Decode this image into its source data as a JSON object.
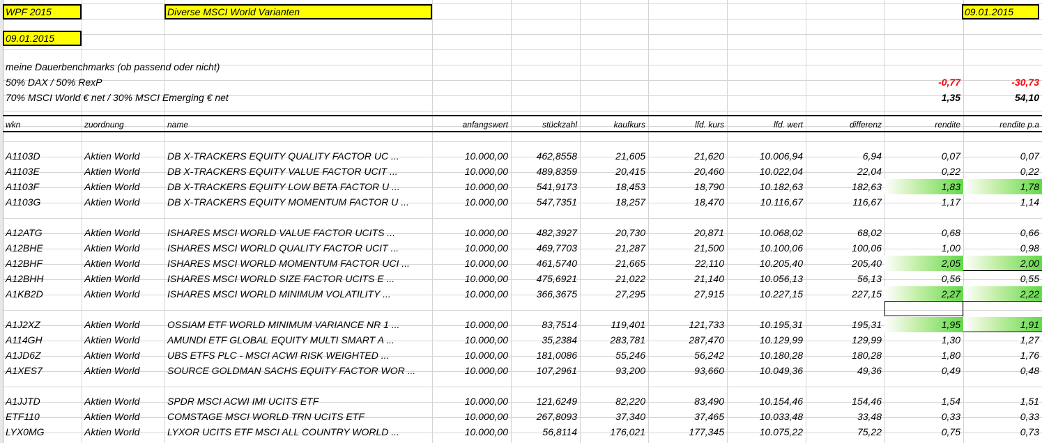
{
  "title_cell": "WPF 2015",
  "subtitle_cell": "Diverse MSCI World Varianten",
  "date_left": "09.01.2015",
  "date_right": "09.01.2015",
  "benchmarks": {
    "heading": "meine Dauerbenchmarks (ob passend oder nicht)",
    "rows": [
      {
        "label": "50% DAX / 50% RexP",
        "rendite": "-0,77",
        "rendite_pa": "-30,73"
      },
      {
        "label": "70% MSCI World € net / 30% MSCI Emerging € net",
        "rendite": "1,35",
        "rendite_pa": "54,10"
      }
    ]
  },
  "columns": [
    "wkn",
    "zuordnung",
    "name",
    "anfangswert",
    "stückzahl",
    "kaufkurs",
    "lfd. kurs",
    "lfd. wert",
    "differenz",
    "rendite",
    "rendite p.a"
  ],
  "rows": [
    [
      "A1103D",
      "Aktien World",
      "DB X-TRACKERS EQUITY QUALITY FACTOR UC ...",
      "10.000,00",
      "462,8558",
      "21,605",
      "21,620",
      "10.006,94",
      "6,94",
      "0,07",
      "0,07"
    ],
    [
      "A1103E",
      "Aktien World",
      "DB X-TRACKERS EQUITY VALUE FACTOR UCIT ...",
      "10.000,00",
      "489,8359",
      "20,415",
      "20,460",
      "10.022,04",
      "22,04",
      "0,22",
      "0,22"
    ],
    [
      "A1103F",
      "Aktien World",
      "DB X-TRACKERS EQUITY LOW BETA FACTOR U ...",
      "10.000,00",
      "541,9173",
      "18,453",
      "18,790",
      "10.182,63",
      "182,63",
      "1,83",
      "1,78"
    ],
    [
      "A1103G",
      "Aktien World",
      "DB X-TRACKERS EQUITY MOMENTUM FACTOR U ...",
      "10.000,00",
      "547,7351",
      "18,257",
      "18,470",
      "10.116,67",
      "116,67",
      "1,17",
      "1,14"
    ],
    [
      "A12ATG",
      "Aktien World",
      "ISHARES MSCI WORLD VALUE FACTOR UCITS ...",
      "10.000,00",
      "482,3927",
      "20,730",
      "20,871",
      "10.068,02",
      "68,02",
      "0,68",
      "0,66"
    ],
    [
      "A12BHE",
      "Aktien World",
      "ISHARES MSCI WORLD QUALITY FACTOR UCIT ...",
      "10.000,00",
      "469,7703",
      "21,287",
      "21,500",
      "10.100,06",
      "100,06",
      "1,00",
      "0,98"
    ],
    [
      "A12BHF",
      "Aktien World",
      "ISHARES MSCI WORLD MOMENTUM FACTOR UCI ...",
      "10.000,00",
      "461,5740",
      "21,665",
      "22,110",
      "10.205,40",
      "205,40",
      "2,05",
      "2,00"
    ],
    [
      "A12BHH",
      "Aktien World",
      "ISHARES MSCI WORLD SIZE FACTOR UCITS E ...",
      "10.000,00",
      "475,6921",
      "21,022",
      "21,140",
      "10.056,13",
      "56,13",
      "0,56",
      "0,55"
    ],
    [
      "A1KB2D",
      "Aktien World",
      "ISHARES MSCI WORLD MINIMUM VOLATILITY ...",
      "10.000,00",
      "366,3675",
      "27,295",
      "27,915",
      "10.227,15",
      "227,15",
      "2,27",
      "2,22"
    ],
    [
      "A1J2XZ",
      "Aktien World",
      "OSSIAM ETF WORLD MINIMUM VARIANCE NR 1 ...",
      "10.000,00",
      "83,7514",
      "119,401",
      "121,733",
      "10.195,31",
      "195,31",
      "1,95",
      "1,91"
    ],
    [
      "A114GH",
      "Aktien World",
      "AMUNDI ETF GLOBAL EQUITY MULTI SMART A ...",
      "10.000,00",
      "35,2384",
      "283,781",
      "287,470",
      "10.129,99",
      "129,99",
      "1,30",
      "1,27"
    ],
    [
      "A1JD6Z",
      "Aktien World",
      "UBS ETFS PLC - MSCI ACWI RISK WEIGHTED ...",
      "10.000,00",
      "181,0086",
      "55,246",
      "56,242",
      "10.180,28",
      "180,28",
      "1,80",
      "1,76"
    ],
    [
      "A1XES7",
      "Aktien World",
      "SOURCE GOLDMAN SACHS EQUITY FACTOR WOR ...",
      "10.000,00",
      "107,2961",
      "93,200",
      "93,660",
      "10.049,36",
      "49,36",
      "0,49",
      "0,48"
    ],
    [
      "A1JJTD",
      "Aktien World",
      "SPDR MSCI ACWI IMI UCITS ETF",
      "10.000,00",
      "121,6249",
      "82,220",
      "83,490",
      "10.154,46",
      "154,46",
      "1,54",
      "1,51"
    ],
    [
      "ETF110",
      "Aktien World",
      "COMSTAGE MSCI WORLD TRN UCITS ETF",
      "10.000,00",
      "267,8093",
      "37,340",
      "37,465",
      "10.033,48",
      "33,48",
      "0,33",
      "0,33"
    ],
    [
      "LYX0MG",
      "Aktien World",
      "LYXOR UCITS ETF MSCI ALL COUNTRY WORLD ...",
      "10.000,00",
      "56,8114",
      "176,021",
      "177,345",
      "10.075,22",
      "75,22",
      "0,75",
      "0,73"
    ]
  ],
  "highlighted_rows": [
    2,
    6,
    8,
    9
  ],
  "colors": {
    "highlight_yellow": "#ffff00",
    "negative": "#ff0000",
    "heat_green": "#63d94a"
  }
}
